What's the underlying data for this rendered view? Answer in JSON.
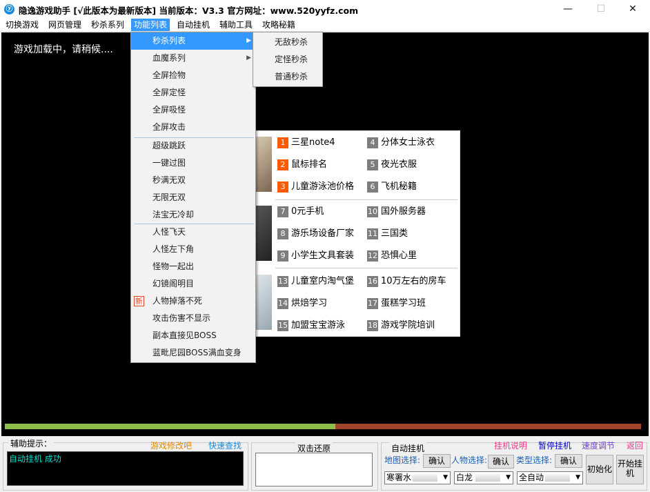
{
  "window": {
    "title": "隐逸游戏助手 [√此版本为最新版本] 当前版本：V3.3 官方网址：www.520yyfz.com",
    "app_icon": "feather-icon",
    "minimize": "—",
    "maximize": "☐",
    "close": "✕"
  },
  "menu": [
    "切换游戏",
    "网页管理",
    "秒杀系列",
    "功能列表",
    "自动挂机",
    "辅助工具",
    "攻略秘籍"
  ],
  "game": {
    "loading": "游戏加载中，请稍候....",
    "progress": 0.52
  },
  "function_menu": {
    "items": [
      "秒杀列表",
      "血魔系列",
      "全屏捡物",
      "全屏定怪",
      "全屏吸怪",
      "全屏攻击",
      "超级跳跃",
      "一键过图",
      "秒满无双",
      "无限无双",
      "法宝无冷却",
      "人怪飞天",
      "人怪左下角",
      "怪物一起出",
      "幻镜阁明目",
      "人物掉落不死",
      "攻击伤害不显示",
      "副本直接见BOSS",
      "蓝毗尼园BOSS满血变身"
    ],
    "new_badge": "新"
  },
  "seckill_submenu": [
    "无敌秒杀",
    "定怪秒杀",
    "普通秒杀"
  ],
  "ad_panel": {
    "items": [
      {
        "n": "1",
        "t": "三星note4"
      },
      {
        "n": "4",
        "t": "分体女士泳衣"
      },
      {
        "n": "2",
        "t": "鼠标排名"
      },
      {
        "n": "5",
        "t": "夜光衣服"
      },
      {
        "n": "3",
        "t": "儿童游泳池价格"
      },
      {
        "n": "6",
        "t": "飞机秘籍"
      },
      {
        "n": "7",
        "t": "0元手机"
      },
      {
        "n": "10",
        "t": "国外服务器"
      },
      {
        "n": "8",
        "t": "游乐场设备厂家"
      },
      {
        "n": "11",
        "t": "三国类"
      },
      {
        "n": "9",
        "t": "小学生文具套装"
      },
      {
        "n": "12",
        "t": "恐惧心里"
      },
      {
        "n": "13",
        "t": "儿童室内淘气堡"
      },
      {
        "n": "16",
        "t": "10万左右的房车"
      },
      {
        "n": "14",
        "t": "烘焙学习"
      },
      {
        "n": "17",
        "t": "蛋糕学习班"
      },
      {
        "n": "15",
        "t": "加盟宝宝游泳"
      },
      {
        "n": "18",
        "t": "游戏学院培训"
      }
    ],
    "hot_color": "#ff5a00",
    "normal_color": "#7d7d7d"
  },
  "assist": {
    "title": "辅助提示：",
    "link_modify": "游戏修改吧",
    "link_search": "快速查找",
    "log": "自动挂机 成功"
  },
  "restore": {
    "title": "双击还原"
  },
  "auto": {
    "title": "自动挂机",
    "links": [
      "挂机说明",
      "暂停挂机",
      "速度调节",
      "返回"
    ],
    "link_colors": [
      "#e83e8c",
      "#0000cc",
      "#6f42c1",
      "#e83e8c"
    ],
    "map_label": "地图选择:",
    "char_label": "人物选择:",
    "type_label": "类型选择:",
    "confirm": "确认",
    "map_value": "寒署水",
    "char_value": "白龙",
    "type_value": "全自动",
    "init": "初始化",
    "start": "开始挂机"
  }
}
